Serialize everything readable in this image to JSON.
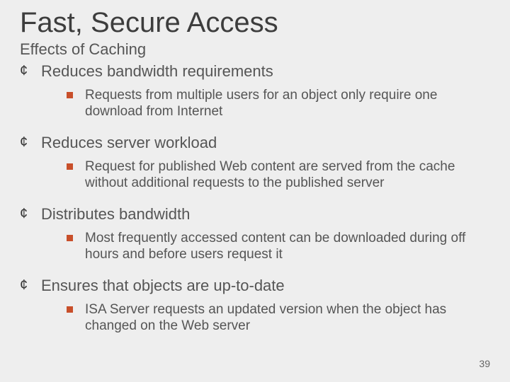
{
  "title": "Fast, Secure Access",
  "subtitle": "Effects of Caching",
  "bullets": [
    {
      "heading": "Reduces bandwidth requirements",
      "sub": "Requests from multiple users for an object only require one download from Internet"
    },
    {
      "heading": "Reduces server workload",
      "sub": "Request for published Web content are served from the cache without additional requests to the published server"
    },
    {
      "heading": "Distributes bandwidth",
      "sub": "Most frequently accessed content can be downloaded during off hours and before users request it"
    },
    {
      "heading": "Ensures that objects are up-to-date",
      "sub": "ISA Server requests an updated version when the object has changed on the Web server"
    }
  ],
  "page_number": "39"
}
